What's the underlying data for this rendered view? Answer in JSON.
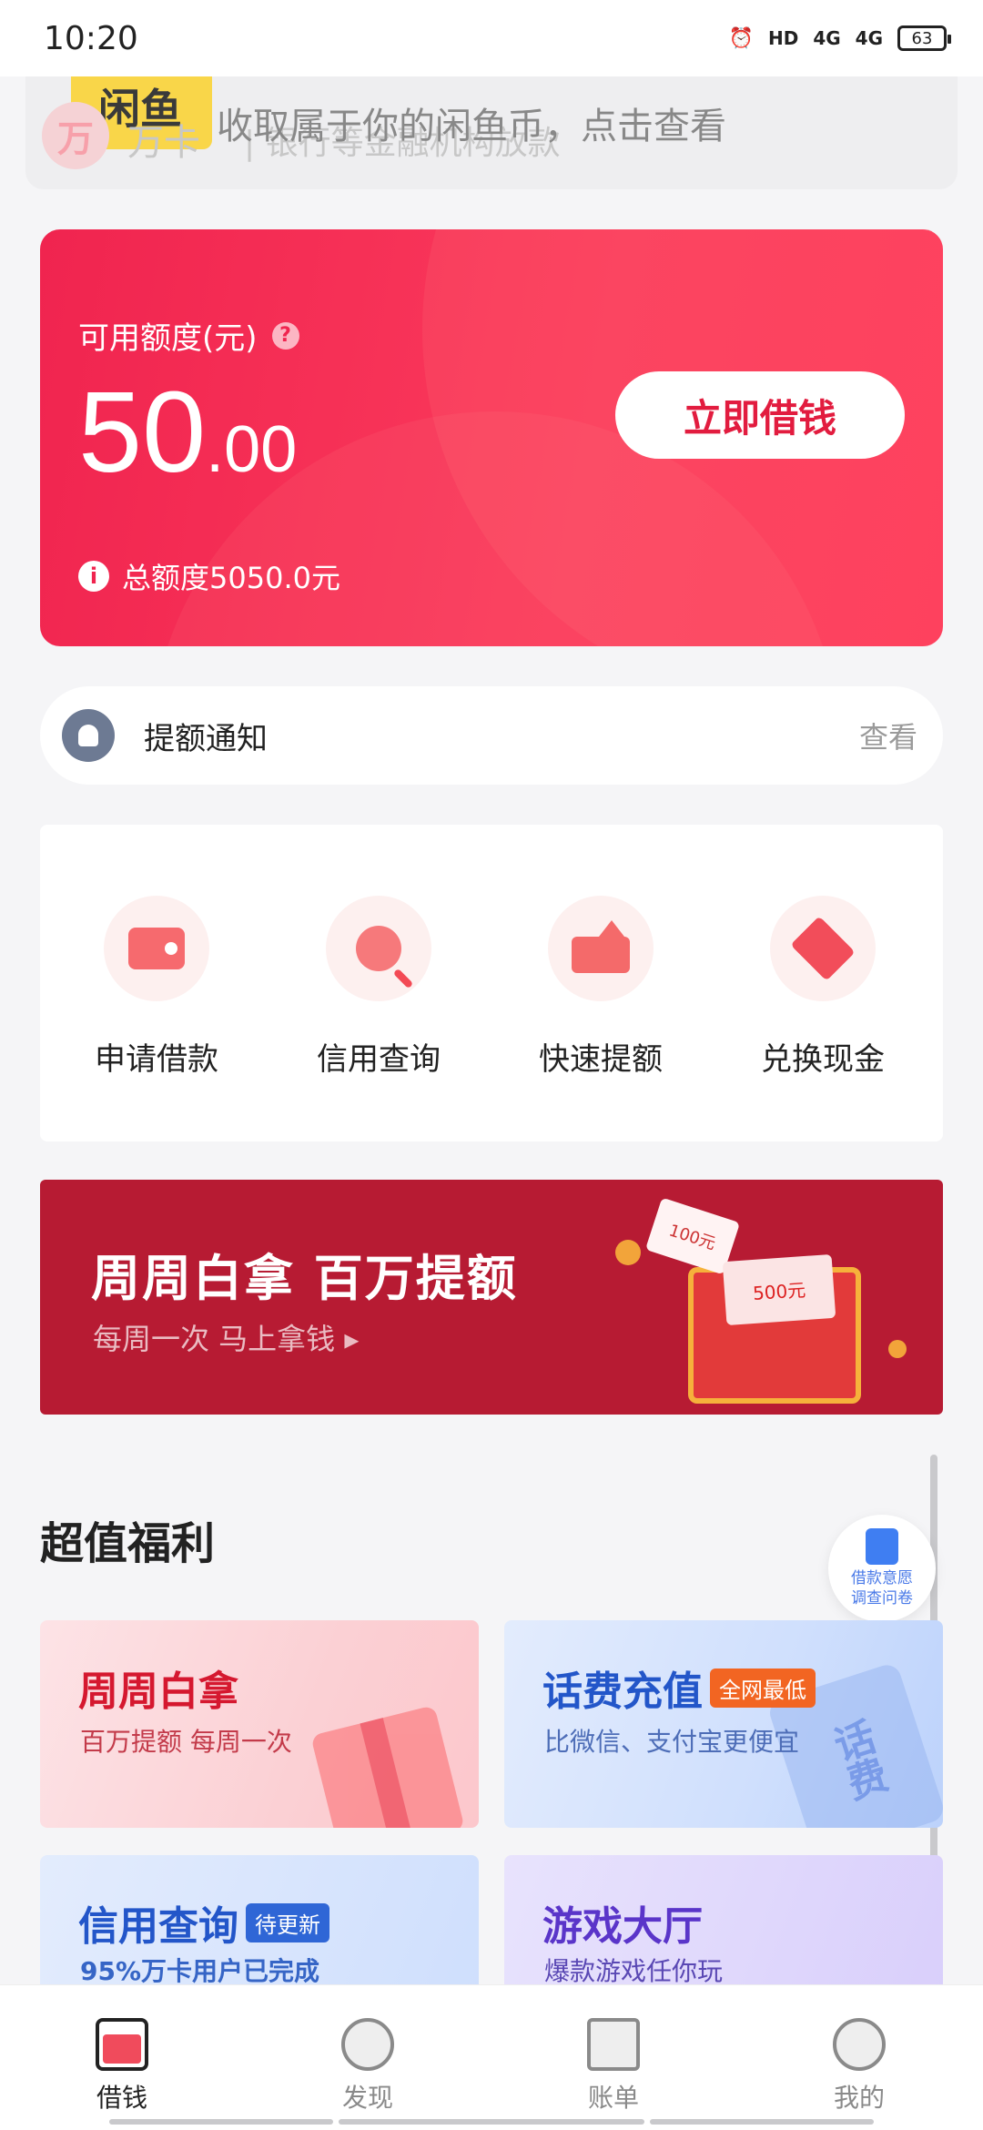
{
  "status_bar": {
    "time": "10:20",
    "hd": "HD",
    "network1": "4G",
    "network2": "4G",
    "battery": "63"
  },
  "top_banner": {
    "logo_text": "闲鱼",
    "logo_icon": "万",
    "brand": "万卡",
    "sub": "| 银行等金融机构放款",
    "text": "收取属于你的闲鱼币，点击查看"
  },
  "credit": {
    "label": "可用额度(元)",
    "help": "?",
    "amount_int": "50",
    "amount_dec": ".00",
    "borrow_button": "立即借钱",
    "info": "i",
    "total": "总额度5050.0元"
  },
  "notify": {
    "label": "提额通知",
    "action": "查看"
  },
  "quick_actions": [
    {
      "label": "申请借款",
      "icon": "wallet-icon"
    },
    {
      "label": "信用查询",
      "icon": "search-icon"
    },
    {
      "label": "快速提额",
      "icon": "upload-icon"
    },
    {
      "label": "兑换现金",
      "icon": "diamond-icon"
    }
  ],
  "promo": {
    "title": "周周白拿 百万提额",
    "subtitle": "每周一次  马上拿钱 ▸",
    "ticket": "100元",
    "note": "500元"
  },
  "section": {
    "title": "超值福利"
  },
  "survey": {
    "line1": "借款意愿",
    "line2": "调查问卷"
  },
  "benefits": [
    {
      "title": "周周白拿",
      "subtitle": "百万提额 每周一次",
      "tag": ""
    },
    {
      "title": "话费充值",
      "subtitle": "比微信、支付宝更便宜",
      "tag": "全网最低",
      "card_text": "话费"
    },
    {
      "title": "信用查询",
      "subtitle": "95%万卡用户已完成",
      "tag": "待更新"
    },
    {
      "title": "游戏大厅",
      "subtitle": "爆款游戏任你玩",
      "tag": ""
    }
  ],
  "tabs": [
    {
      "label": "借钱",
      "active": true
    },
    {
      "label": "发现",
      "active": false
    },
    {
      "label": "账单",
      "active": false
    },
    {
      "label": "我的",
      "active": false
    }
  ],
  "colors": {
    "brand_red": "#f0244f",
    "promo_red": "#b71b33",
    "tag_orange": "#f26522",
    "tag_blue": "#2f66d6"
  }
}
